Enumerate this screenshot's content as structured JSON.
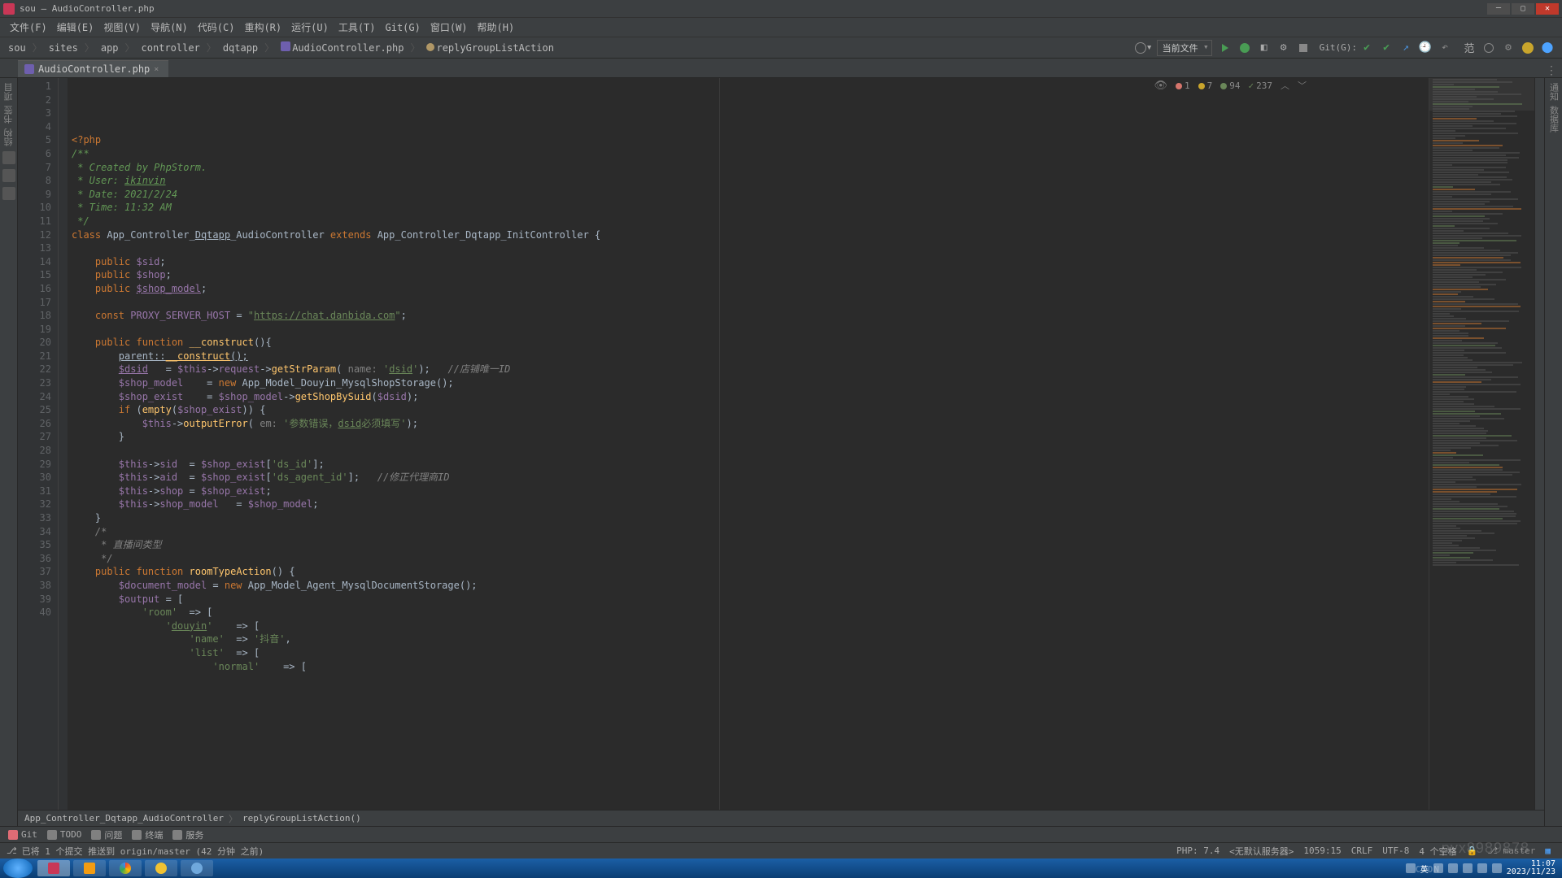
{
  "window": {
    "title": "sou – AudioController.php"
  },
  "menu": [
    "文件(F)",
    "编辑(E)",
    "视图(V)",
    "导航(N)",
    "代码(C)",
    "重构(R)",
    "运行(U)",
    "工具(T)",
    "Git(G)",
    "窗口(W)",
    "帮助(H)"
  ],
  "breadcrumb": [
    "sou",
    "sites",
    "app",
    "controller",
    "dqtapp",
    "AudioController.php",
    "replyGroupListAction"
  ],
  "run_config": "当前文件",
  "git_label": "Git(G):",
  "tab": {
    "name": "AudioController.php"
  },
  "inspection": {
    "errors": "1",
    "warnings": "7",
    "weak": "94",
    "typos": "237"
  },
  "code_lines": [
    {
      "n": 1,
      "html": "<span class='kw'>&lt;?php</span>"
    },
    {
      "n": 2,
      "html": "<span class='ucom'>/**</span>"
    },
    {
      "n": 3,
      "html": "<span class='ucom'> * Created by PhpStorm.</span>"
    },
    {
      "n": 4,
      "html": "<span class='ucom'> * User: </span><span class='ucom und'>ikinvin</span>"
    },
    {
      "n": 5,
      "html": "<span class='ucom'> * Date: 2021/2/24</span>"
    },
    {
      "n": 6,
      "html": "<span class='ucom'> * Time: 11:32 AM</span>"
    },
    {
      "n": 7,
      "html": "<span class='ucom'> */</span>"
    },
    {
      "n": 8,
      "html": "<span class='kw'>class</span> App_Controller_<span class='und'>Dqtapp</span>_AudioController <span class='kw'>extends</span> App_Controller_Dqtapp_InitController {"
    },
    {
      "n": 9,
      "html": ""
    },
    {
      "n": 10,
      "html": "    <span class='kw'>public</span> <span class='var'>$sid</span>;"
    },
    {
      "n": 11,
      "html": "    <span class='kw'>public</span> <span class='var'>$shop</span>;"
    },
    {
      "n": 12,
      "html": "    <span class='kw'>public</span> <span class='var und'>$shop_model</span>;"
    },
    {
      "n": 13,
      "html": ""
    },
    {
      "n": 14,
      "html": "    <span class='kw'>const</span> <span class='var'>PROXY_SERVER_HOST</span> = <span class='str'>\"<span class='und'>https://chat.danbida.com</span>\"</span>;"
    },
    {
      "n": 15,
      "html": ""
    },
    {
      "n": 16,
      "html": "    <span class='kw'>public function</span> <span class='fn'>__construct</span>(){"
    },
    {
      "n": 17,
      "html": "        <span class='und'>parent::</span><span class='fn und'>__construct</span><span class='und'>();</span>"
    },
    {
      "n": 18,
      "html": "        <span class='var und'>$dsid</span>   = <span class='var'>$this</span>-&gt;<span class='var'>request</span>-&gt;<span class='fn'>getStrParam</span>( <span class='param'>name:</span> <span class='str'>'<span class='und'>dsid</span>'</span>);   <span class='com'>//店铺唯一ID</span>"
    },
    {
      "n": 19,
      "html": "        <span class='var'>$shop_model</span>    = <span class='kw'>new</span> App_Model_Douyin_MysqlShopStorage();"
    },
    {
      "n": 20,
      "html": "        <span class='var'>$shop_exist</span>    = <span class='var'>$shop_model</span>-&gt;<span class='fn'>getShopBySuid</span>(<span class='var'>$dsid</span>);"
    },
    {
      "n": 21,
      "html": "        <span class='kw'>if</span> (<span class='fn'>empty</span>(<span class='var'>$shop_exist</span>)) {"
    },
    {
      "n": 22,
      "html": "            <span class='var'>$this</span>-&gt;<span class='fn'>outputError</span>( <span class='param'>em:</span> <span class='str'>'参数错误，<span class='und'>dsid</span>必须填写'</span>);"
    },
    {
      "n": 23,
      "html": "        }"
    },
    {
      "n": 24,
      "html": ""
    },
    {
      "n": 25,
      "html": "        <span class='var'>$this</span>-&gt;<span class='var'>sid</span>  = <span class='var'>$shop_exist</span>[<span class='str'>'ds_id'</span>];"
    },
    {
      "n": 26,
      "html": "        <span class='var'>$this</span>-&gt;<span class='var'>aid</span>  = <span class='var'>$shop_exist</span>[<span class='str'>'ds_agent_id'</span>];   <span class='com'>//修正代理商ID</span>"
    },
    {
      "n": 27,
      "html": "        <span class='var'>$this</span>-&gt;<span class='var'>shop</span> = <span class='var'>$shop_exist</span>;"
    },
    {
      "n": 28,
      "html": "        <span class='var'>$this</span>-&gt;<span class='var'>shop_model</span>   = <span class='var'>$shop_model</span>;"
    },
    {
      "n": 29,
      "html": "    }"
    },
    {
      "n": 30,
      "html": "    <span class='com'>/*</span>"
    },
    {
      "n": 31,
      "html": "    <span class='com'> * 直播间类型</span>"
    },
    {
      "n": 32,
      "html": "    <span class='com'> */</span>"
    },
    {
      "n": 33,
      "html": "    <span class='kw'>public function</span> <span class='fn'>roomTypeAction</span>() {"
    },
    {
      "n": 34,
      "html": "        <span class='var'>$document_model</span> = <span class='kw'>new</span> App_Model_Agent_MysqlDocumentStorage();"
    },
    {
      "n": 35,
      "html": "        <span class='var'>$output</span> = ["
    },
    {
      "n": 36,
      "html": "            <span class='str'>'room'</span>  =&gt; ["
    },
    {
      "n": 37,
      "html": "                <span class='str'>'<span class='und'>douyin</span>'</span>    =&gt; ["
    },
    {
      "n": 38,
      "html": "                    <span class='str'>'name'</span>  =&gt; <span class='str'>'抖音'</span>,"
    },
    {
      "n": 39,
      "html": "                    <span class='str'>'list'</span>  =&gt; ["
    },
    {
      "n": 40,
      "html": "                        <span class='str'>'normal'</span>    =&gt; ["
    }
  ],
  "editor_crumbs": [
    "App_Controller_Dqtapp_AudioController",
    "replyGroupListAction()"
  ],
  "tool_tabs": [
    {
      "icon": "#e06c75",
      "label": "Git"
    },
    {
      "icon": "#808080",
      "label": "TODO"
    },
    {
      "icon": "#808080",
      "label": "问题"
    },
    {
      "icon": "#808080",
      "label": "终端"
    },
    {
      "icon": "#808080",
      "label": "服务"
    }
  ],
  "status": {
    "left": "已将 1 个提交 推送到 origin/master (42 分钟 之前)",
    "php": "PHP: 7.4",
    "server": "<无默认服务器>",
    "pos": "1059:15",
    "le": "CRLF",
    "enc": "UTF-8",
    "indent": "4 个空格",
    "branch": "master"
  },
  "left_labels": [
    "项目",
    "书签",
    "结构"
  ],
  "right_labels": [
    "通知",
    "数据库"
  ],
  "clock": {
    "time": "11:07",
    "date": "2023/11/23"
  },
  "tray_ime": "英",
  "watermark": "pyx8989878",
  "csdn": "CSDN"
}
